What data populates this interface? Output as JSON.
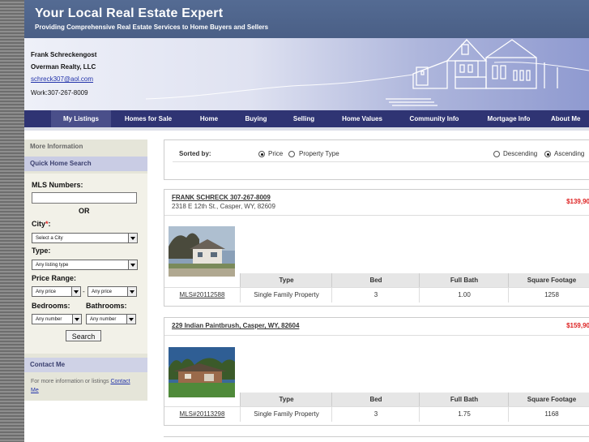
{
  "header": {
    "title": "Your Local Real Estate Expert",
    "subtitle": "Providing Comprehensive Real Estate Services to Home Buyers and Sellers"
  },
  "agent": {
    "name": "Frank Schreckengost",
    "company": "Overman Realty, LLC",
    "email": "schreck307@aol.com",
    "work": "Work:307-267-8009"
  },
  "nav": {
    "items": [
      {
        "label": "My Listings",
        "active": true
      },
      {
        "label": "Homes for Sale"
      },
      {
        "label": "Home"
      },
      {
        "label": "Buying"
      },
      {
        "label": "Selling"
      },
      {
        "label": "Home Values"
      },
      {
        "label": "Community Info"
      },
      {
        "label": "Mortgage Info"
      },
      {
        "label": "About Me"
      }
    ]
  },
  "sidebar": {
    "more_info": "More Information",
    "quick_search": "Quick Home Search",
    "mls_label": "MLS Numbers:",
    "or_label": "OR",
    "city_label": "City",
    "city_required": "*",
    "city_colon": ":",
    "city_select": "Select a City",
    "type_label": "Type:",
    "type_select": "Any listing type",
    "price_label": "Price Range:",
    "price_min": "Any price",
    "price_dash": "-",
    "price_max": "Any price",
    "bedrooms_label": "Bedrooms:",
    "bathrooms_label": "Bathrooms:",
    "bed_select": "Any number",
    "bath_select": "Any number",
    "search_button": "Search",
    "contact_head": "Contact Me",
    "contact_text": "For more information or listings",
    "contact_link": "Contact Me"
  },
  "sort": {
    "label": "Sorted by:",
    "price": "Price",
    "property_type": "Property Type",
    "descending": "Descending",
    "ascending": "Ascending",
    "selected_field": "price",
    "selected_order": "ascending"
  },
  "table_headers": [
    "Type",
    "Bed",
    "Full Bath",
    "Square Footage"
  ],
  "listings": [
    {
      "title": "FRANK SCHRECK 307-267-8009",
      "address": "2318 E 12th St., Casper, WY, 82609",
      "price": "$139,90",
      "mls": "MLS#20112588",
      "type": "Single Family Property",
      "bed": "3",
      "full_bath": "1.00",
      "sqft": "1258"
    },
    {
      "title": "229 Indian Paintbrush, Casper, WY, 82604",
      "address": "",
      "price": "$159,90",
      "mls": "MLS#20113298",
      "type": "Single Family Property",
      "bed": "3",
      "full_bath": "1.75",
      "sqft": "1168"
    }
  ],
  "colors": {
    "nav_bg": "#2f3473",
    "price": "#dd2222",
    "header_bg": "#4f6590"
  }
}
